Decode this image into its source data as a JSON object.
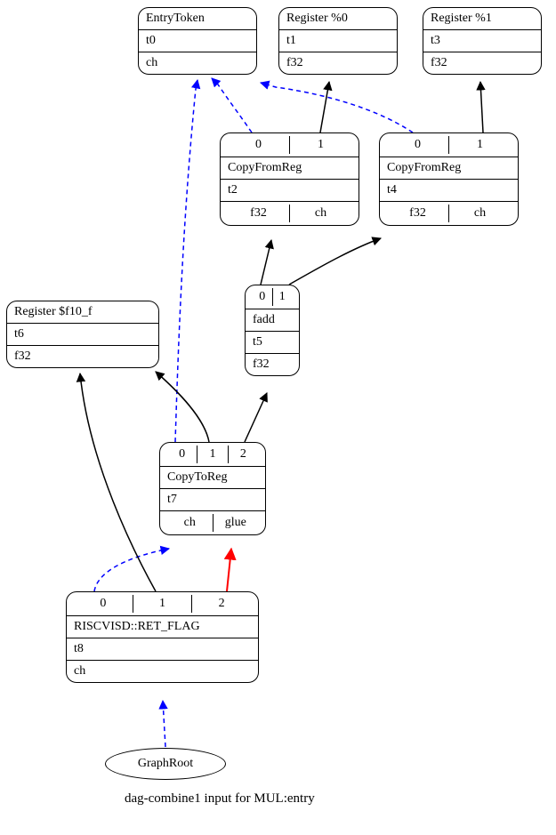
{
  "nodes": {
    "entryToken": {
      "title": "EntryToken",
      "tval": "t0",
      "type": "ch"
    },
    "reg0": {
      "title": "Register %0",
      "tval": "t1",
      "type": "f32"
    },
    "reg1": {
      "title": "Register %1",
      "tval": "t3",
      "type": "f32"
    },
    "regf10": {
      "title": "Register $f10_f",
      "tval": "t6",
      "type": "f32"
    },
    "copyFromReg1": {
      "title": "CopyFromReg",
      "tval": "t2",
      "out0": "f32",
      "out1": "ch",
      "in0": "0",
      "in1": "1"
    },
    "copyFromReg2": {
      "title": "CopyFromReg",
      "tval": "t4",
      "out0": "f32",
      "out1": "ch",
      "in0": "0",
      "in1": "1"
    },
    "fadd": {
      "title": "fadd",
      "tval": "t5",
      "type": "f32",
      "in0": "0",
      "in1": "1"
    },
    "copyToReg": {
      "title": "CopyToReg",
      "tval": "t7",
      "out0": "ch",
      "out1": "glue",
      "in0": "0",
      "in1": "1",
      "in2": "2"
    },
    "retFlag": {
      "title": "RISCVISD::RET_FLAG",
      "tval": "t8",
      "type": "ch",
      "in0": "0",
      "in1": "1",
      "in2": "2"
    },
    "graphRoot": {
      "title": "GraphRoot"
    }
  },
  "caption": "dag-combine1 input for MUL:entry"
}
